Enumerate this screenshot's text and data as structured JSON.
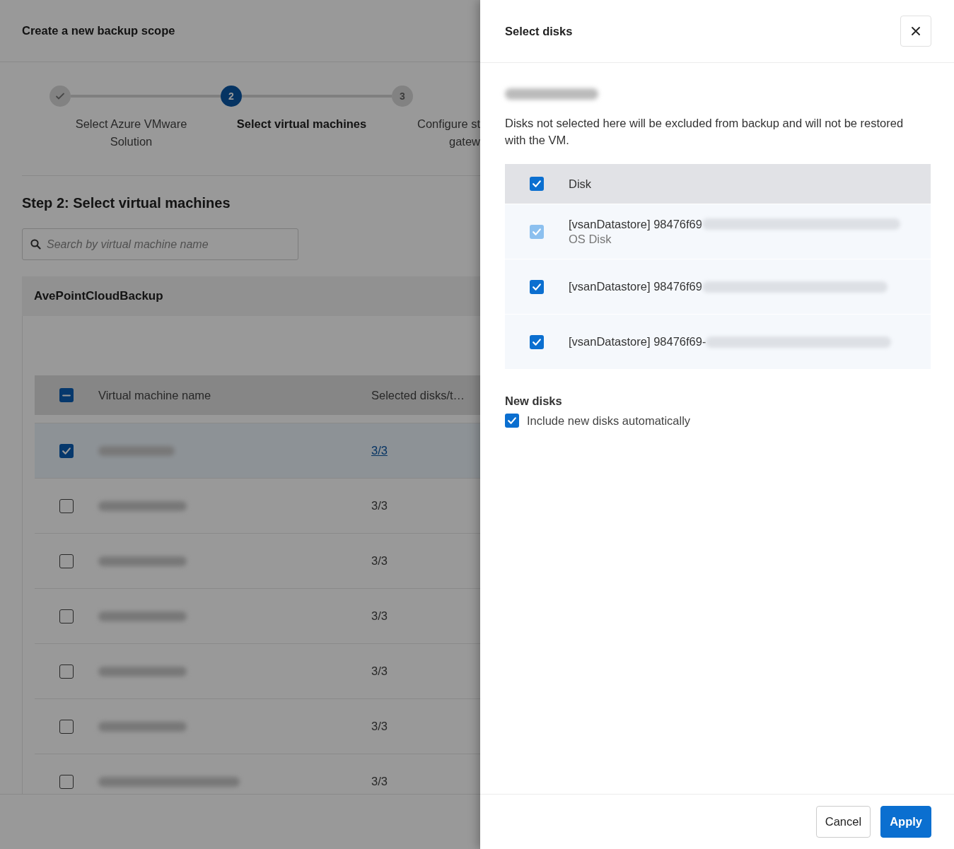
{
  "page": {
    "title": "Create a new backup scope"
  },
  "steps": [
    {
      "label_lines": [
        "Select Azure VMware",
        "Solution"
      ],
      "completed": true,
      "selected": false
    },
    {
      "label_lines": [
        "Select virtual machines"
      ],
      "completed": false,
      "selected": true,
      "number": "2"
    },
    {
      "label_lines": [
        "Configure st",
        "gatew"
      ],
      "completed": false,
      "selected": false,
      "number": "3"
    }
  ],
  "section_title": "Step 2: Select virtual machines",
  "search": {
    "placeholder": "Search by virtual machine name"
  },
  "group": {
    "name": "AvePointCloudBackup",
    "columns": [
      "Virtual machine name",
      "Selected disks/t…"
    ],
    "select_all_indeterminate": true,
    "rows": [
      {
        "selected": true,
        "disks": "3/3",
        "link": true
      },
      {
        "selected": false,
        "disks": "3/3",
        "link": false
      },
      {
        "selected": false,
        "disks": "3/3",
        "link": false
      },
      {
        "selected": false,
        "disks": "3/3",
        "link": false
      },
      {
        "selected": false,
        "disks": "3/3",
        "link": false
      },
      {
        "selected": false,
        "disks": "3/3",
        "link": false
      },
      {
        "selected": false,
        "disks": "3/3",
        "link": false
      }
    ]
  },
  "drawer": {
    "title": "Select disks",
    "description": "Disks not selected here will be excluded from backup and will not be restored with the VM.",
    "column": "Disk",
    "select_all_checked": true,
    "disks": [
      {
        "name": "[vsanDatastore] 98476f69",
        "note": "OS Disk",
        "checked": true,
        "disabled": true
      },
      {
        "name": "[vsanDatastore] 98476f69",
        "checked": true,
        "disabled": false
      },
      {
        "name": "[vsanDatastore] 98476f69-",
        "checked": true,
        "disabled": false
      }
    ],
    "new_disks": {
      "title": "New disks",
      "label": "Include new disks automatically",
      "checked": true
    },
    "buttons": [
      {
        "label": "Cancel",
        "kind": "secondary"
      },
      {
        "label": "Apply",
        "kind": "primary"
      }
    ]
  }
}
